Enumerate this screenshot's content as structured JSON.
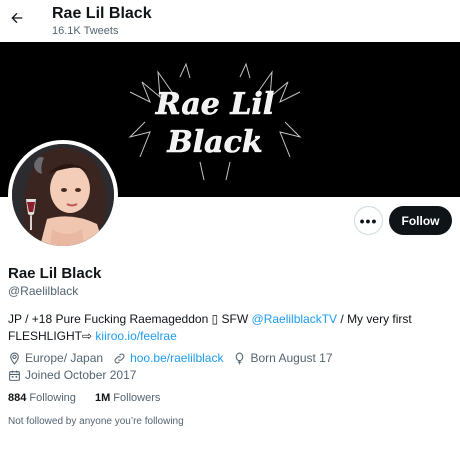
{
  "header": {
    "title": "Rae Lil Black",
    "tweet_count": "16.1K Tweets",
    "back_icon": "arrow-left-icon"
  },
  "banner": {
    "logo_text_line1": "Rae Lil",
    "logo_text_line2": "Black",
    "background": "#000000"
  },
  "actions": {
    "more_label": "•••",
    "follow_label": "Follow"
  },
  "profile": {
    "name": "Rae Lil Black",
    "handle": "@Raelilblack",
    "bio_text1": "JP / +18 Pure Fucking Raemageddon ▯ SFW ",
    "bio_link1": "@RaelilblackTV",
    "bio_text2": " / My very first FLESHLIGHT⇨ ",
    "bio_link2": "kiiroo.io/feelrae",
    "location": "Europe/ Japan",
    "website": "hoo.be/raelilblack",
    "birthday": "Born August 17",
    "joined": "Joined October 2017"
  },
  "stats": {
    "following_count": "884",
    "following_label": "Following",
    "followers_count": "1M",
    "followers_label": "Followers"
  },
  "followed_by": "Not followed by anyone you’re following",
  "colors": {
    "accent": "#1d9bf0",
    "text_primary": "#0f1419",
    "text_secondary": "#536471",
    "button_dark": "#0f1419"
  }
}
